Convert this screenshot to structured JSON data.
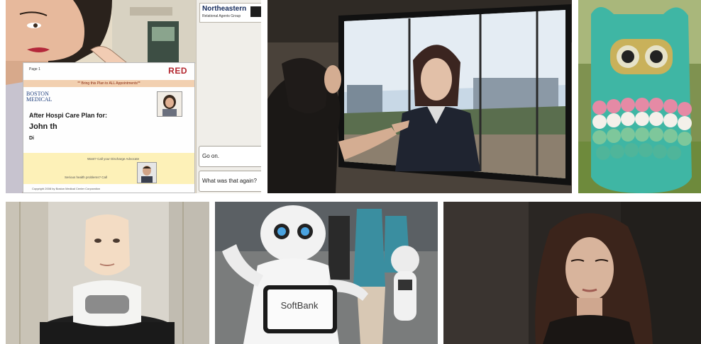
{
  "panel1": {
    "logo_name": "Northeastern",
    "logo_sub": "Relational Agents Group",
    "doc": {
      "page_label": "Page 1",
      "red_logo": "RED",
      "banner": "** Bring this Plan to ALL Appointments**",
      "hospital_logo": "BOSTON MEDICAL",
      "title_line1": "After Hospi    Care Plan for:",
      "title_line2": "John     th",
      "title_line3": "Di",
      "question1": "Want? Call your Discharge Advocate",
      "question2": "Serious health problems? Call",
      "copyright": "Copyright 2008 by Boston Medical Center Corporation"
    },
    "buttons": {
      "go_on": "Go on.",
      "again": "What was that again?"
    }
  },
  "panel5": {
    "tablet_brand": "SoftBank"
  }
}
